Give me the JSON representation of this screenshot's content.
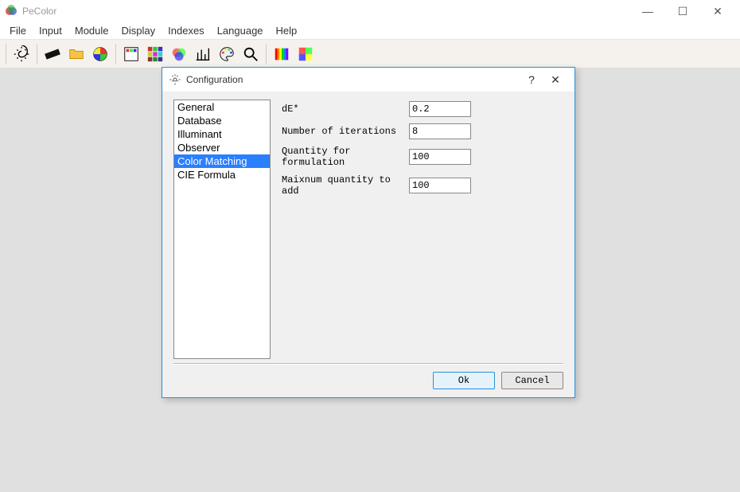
{
  "app": {
    "title": "PeColor"
  },
  "window_controls": {
    "min": "—",
    "max": "☐",
    "close": "✕"
  },
  "menu": [
    "File",
    "Input",
    "Module",
    "Display",
    "Indexes",
    "Language",
    "Help"
  ],
  "toolbar_icons": [
    "settings-icon",
    "swatch-icon",
    "folder-icon",
    "color-wheel-icon",
    "palette-icon",
    "grid-colors-icon",
    "rgb-venn-icon",
    "chart-icon",
    "art-palette-icon",
    "zoom-icon",
    "spectrum-icon",
    "color-quad-icon"
  ],
  "dialog": {
    "title": "Configuration",
    "help": "?",
    "close": "✕",
    "categories": [
      {
        "label": "General",
        "selected": false
      },
      {
        "label": "Database",
        "selected": false
      },
      {
        "label": "Illuminant",
        "selected": false
      },
      {
        "label": "Observer",
        "selected": false
      },
      {
        "label": "Color Matching",
        "selected": true
      },
      {
        "label": "CIE Formula",
        "selected": false
      }
    ],
    "fields": [
      {
        "label": "dE*",
        "value": "0.2"
      },
      {
        "label": "Number of iterations",
        "value": "8"
      },
      {
        "label": "Quantity for formulation",
        "value": "100"
      },
      {
        "label": "Maixnum quantity to add",
        "value": "100"
      }
    ],
    "buttons": {
      "ok": "Ok",
      "cancel": "Cancel"
    }
  }
}
